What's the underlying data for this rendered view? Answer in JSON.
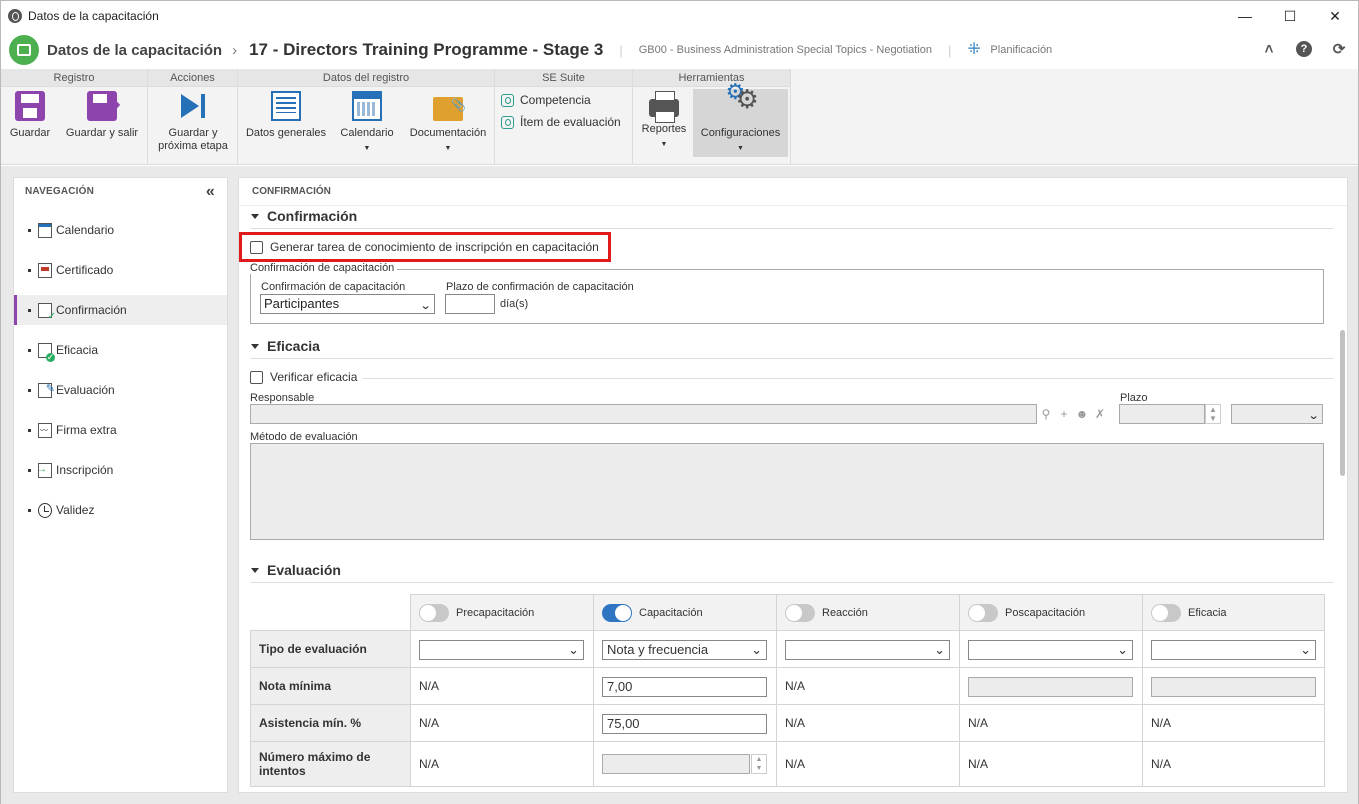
{
  "window": {
    "title": "Datos de la capacitación"
  },
  "header": {
    "module": "Datos de la capacitación",
    "record": "17 - Directors Training Programme - Stage 3",
    "course": "GB00 - Business Administration Special Topics - Negotiation",
    "status": "Planificación"
  },
  "ribbon": {
    "groups": {
      "registro": "Registro",
      "acciones": "Acciones",
      "datos": "Datos del registro",
      "suite": "SE Suite",
      "herramientas": "Herramientas"
    },
    "guardar": "Guardar",
    "guardar_salir": "Guardar y salir",
    "guardar_proxima_1": "Guardar y",
    "guardar_proxima_2": "próxima etapa",
    "datos_generales": "Datos generales",
    "calendario": "Calendario",
    "documentacion": "Documentación",
    "competencia": "Competencia",
    "item_evaluacion": "Ítem de evaluación",
    "reportes": "Reportes",
    "configuraciones": "Configuraciones"
  },
  "nav": {
    "title": "NAVEGACIÓN",
    "items": [
      "Calendario",
      "Certificado",
      "Confirmación",
      "Eficacia",
      "Evaluación",
      "Firma extra",
      "Inscripción",
      "Validez"
    ],
    "active": "Confirmación"
  },
  "main": {
    "title": "CONFIRMACIÓN",
    "confirmacion": {
      "section": "Confirmación",
      "task_checkbox": "Generar tarea de conocimiento de inscripción en capacitación",
      "fieldset": "Confirmación de capacitación",
      "conf_label": "Confirmación de capacitación",
      "conf_value": "Participantes",
      "plazo_label": "Plazo de confirmación de capacitación",
      "plazo_value": "",
      "plazo_unit": "día(s)"
    },
    "eficacia": {
      "section": "Eficacia",
      "verify_checkbox": "Verificar eficacia",
      "responsable_label": "Responsable",
      "plazo_label": "Plazo",
      "metodo_label": "Método de evaluación"
    },
    "evaluacion": {
      "section": "Evaluación",
      "columns": [
        {
          "label": "Precapacitación",
          "on": false
        },
        {
          "label": "Capacitación",
          "on": true
        },
        {
          "label": "Reacción",
          "on": false
        },
        {
          "label": "Poscapacitación",
          "on": false
        },
        {
          "label": "Eficacia",
          "on": false
        }
      ],
      "rows": {
        "tipo": "Tipo de evaluación",
        "nota": "Nota mínima",
        "asistencia": "Asistencia mín. %",
        "intentos": "Número máximo de intentos"
      },
      "tipo_values": [
        "",
        "Nota y frecuencia",
        "",
        "",
        ""
      ],
      "nota_values": [
        "N/A",
        "7,00",
        "N/A",
        "",
        ""
      ],
      "asistencia_values": [
        "N/A",
        "75,00",
        "N/A",
        "N/A",
        "N/A"
      ],
      "intentos_values": [
        "N/A",
        "",
        "N/A",
        "N/A",
        "N/A"
      ]
    }
  },
  "colors": {
    "accent": "#8e44ad",
    "blue": "#2670b8",
    "highlight": "#e01b1b",
    "toggle_on": "#2f75c4"
  }
}
